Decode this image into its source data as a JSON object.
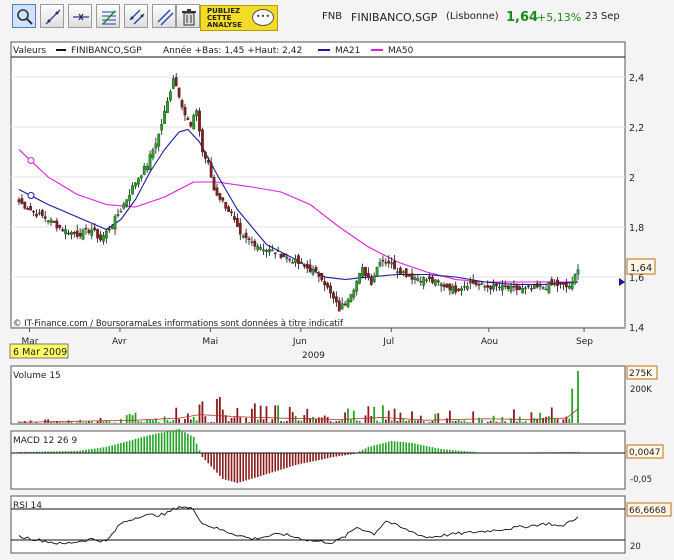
{
  "toolbar": {
    "tools": [
      {
        "name": "zoom-tool",
        "icon": "magnifier-icon"
      },
      {
        "name": "trend-line-tool",
        "icon": "trend-line-icon"
      },
      {
        "name": "horizontal-line-tool",
        "icon": "horizontal-line-icon"
      },
      {
        "name": "fibonacci-tool",
        "icon": "fibonacci-icon"
      },
      {
        "name": "channel-tool",
        "icon": "channel-icon"
      },
      {
        "name": "parallel-lines-tool",
        "icon": "parallel-lines-icon"
      },
      {
        "name": "delete-tool",
        "icon": "trash-icon"
      }
    ],
    "promo_text": "PUBLIEZ\nCETTE\nANALYSE"
  },
  "quote": {
    "code": "FNB",
    "name": "FINIBANCO,SGP",
    "exchange": "(Lisbonne)",
    "price": "1,64",
    "change": "+5,13%",
    "date": "23 Sep"
  },
  "colors": {
    "up": "#22a522",
    "down": "#8c1a1a",
    "ma21": "#1a1aa0",
    "ma50": "#e01ee0",
    "volume": "#22a522",
    "volume_down": "#8c1a1a",
    "price_tag": "#fff7e8",
    "date_tag": "#ffff66"
  },
  "main_panel": {
    "legend": {
      "label": "Valeurs",
      "series_name": "FINIBANCO,SGP",
      "range_text": "Année +Bas: 1,45 +Haut: 2,42",
      "ma21_label": "MA21",
      "ma50_label": "MA50"
    },
    "credit": "© IT-Finance.com / BoursoramaLes informations sont données à titre indicatif",
    "price_tag": "1,64",
    "y_ticks": [
      "2,4",
      "2,2",
      "2",
      "1,8",
      "1,6",
      "1,4"
    ],
    "x_months": [
      "Mar",
      "Avr",
      "Mai",
      "Jun",
      "Jul",
      "Aou",
      "Sep"
    ],
    "year_label": "2009",
    "date_tag": "6 Mar 2009"
  },
  "volume_panel": {
    "label": "Volume 15",
    "value_tag": "275K",
    "ticks": [
      "200K"
    ]
  },
  "macd_panel": {
    "label": "MACD 12 26 9",
    "value_tag": "0,0047",
    "ticks": [
      "-0,05"
    ]
  },
  "rsi_panel": {
    "label": "RSI 14",
    "value_tag": "66,6668",
    "ticks": [
      "20"
    ]
  },
  "chart_data": {
    "type": "candlestick",
    "title": "FINIBANCO,SGP",
    "ylim": [
      1.4,
      2.45
    ],
    "x_months": [
      "Mar",
      "Avr",
      "Mai",
      "Jun",
      "Jul",
      "Aou",
      "Sep"
    ],
    "close_anchors": [
      [
        0,
        1.9
      ],
      [
        5,
        1.86
      ],
      [
        10,
        1.83
      ],
      [
        15,
        1.79
      ],
      [
        20,
        1.77
      ],
      [
        25,
        1.79
      ],
      [
        28,
        1.75
      ],
      [
        32,
        1.81
      ],
      [
        35,
        1.87
      ],
      [
        40,
        1.98
      ],
      [
        44,
        2.05
      ],
      [
        48,
        2.17
      ],
      [
        51,
        2.3
      ],
      [
        53,
        2.4
      ],
      [
        55,
        2.33
      ],
      [
        57,
        2.25
      ],
      [
        59,
        2.2
      ],
      [
        61,
        2.27
      ],
      [
        63,
        2.1
      ],
      [
        65,
        2.05
      ],
      [
        67,
        1.95
      ],
      [
        70,
        1.9
      ],
      [
        73,
        1.85
      ],
      [
        76,
        1.76
      ],
      [
        80,
        1.74
      ],
      [
        85,
        1.71
      ],
      [
        90,
        1.69
      ],
      [
        95,
        1.66
      ],
      [
        100,
        1.63
      ],
      [
        104,
        1.6
      ],
      [
        107,
        1.53
      ],
      [
        110,
        1.47
      ],
      [
        112,
        1.5
      ],
      [
        115,
        1.56
      ],
      [
        118,
        1.63
      ],
      [
        121,
        1.58
      ],
      [
        124,
        1.67
      ],
      [
        127,
        1.66
      ],
      [
        130,
        1.63
      ],
      [
        135,
        1.6
      ],
      [
        140,
        1.59
      ],
      [
        145,
        1.57
      ],
      [
        150,
        1.55
      ],
      [
        155,
        1.58
      ],
      [
        160,
        1.56
      ],
      [
        165,
        1.56
      ],
      [
        170,
        1.55
      ],
      [
        175,
        1.55
      ],
      [
        180,
        1.56
      ],
      [
        184,
        1.57
      ],
      [
        188,
        1.56
      ],
      [
        190,
        1.57
      ],
      [
        192,
        1.64
      ]
    ],
    "ma21_anchors": [
      [
        0,
        1.95
      ],
      [
        10,
        1.89
      ],
      [
        20,
        1.84
      ],
      [
        30,
        1.79
      ],
      [
        35,
        1.83
      ],
      [
        40,
        1.91
      ],
      [
        45,
        2.02
      ],
      [
        50,
        2.11
      ],
      [
        55,
        2.18
      ],
      [
        58,
        2.19
      ],
      [
        62,
        2.14
      ],
      [
        68,
        2.01
      ],
      [
        75,
        1.87
      ],
      [
        85,
        1.73
      ],
      [
        95,
        1.67
      ],
      [
        105,
        1.6
      ],
      [
        112,
        1.59
      ],
      [
        120,
        1.6
      ],
      [
        130,
        1.61
      ],
      [
        140,
        1.61
      ],
      [
        150,
        1.6
      ],
      [
        160,
        1.58
      ],
      [
        170,
        1.57
      ],
      [
        180,
        1.57
      ],
      [
        192,
        1.58
      ]
    ],
    "ma50_anchors": [
      [
        0,
        2.11
      ],
      [
        10,
        2.0
      ],
      [
        20,
        1.93
      ],
      [
        30,
        1.89
      ],
      [
        40,
        1.88
      ],
      [
        50,
        1.92
      ],
      [
        60,
        1.98
      ],
      [
        68,
        1.98
      ],
      [
        80,
        1.96
      ],
      [
        90,
        1.94
      ],
      [
        100,
        1.89
      ],
      [
        110,
        1.8
      ],
      [
        120,
        1.72
      ],
      [
        130,
        1.66
      ],
      [
        140,
        1.62
      ],
      [
        150,
        1.59
      ],
      [
        160,
        1.58
      ],
      [
        170,
        1.58
      ],
      [
        180,
        1.58
      ],
      [
        192,
        1.58
      ]
    ],
    "volume_peak": [
      [
        0,
        0.05
      ],
      [
        40,
        0.2
      ],
      [
        55,
        0.35
      ],
      [
        62,
        0.6
      ],
      [
        75,
        0.45
      ],
      [
        90,
        0.35
      ],
      [
        110,
        0.25
      ],
      [
        125,
        0.4
      ],
      [
        140,
        0.2
      ],
      [
        160,
        0.3
      ],
      [
        175,
        0.25
      ],
      [
        188,
        0.35
      ],
      [
        192,
        1.0
      ]
    ],
    "macd": [
      [
        0,
        0.005
      ],
      [
        20,
        0.01
      ],
      [
        30,
        0.03
      ],
      [
        45,
        0.09
      ],
      [
        55,
        0.12
      ],
      [
        60,
        0.08
      ],
      [
        63,
        -0.02
      ],
      [
        70,
        -0.13
      ],
      [
        75,
        -0.15
      ],
      [
        82,
        -0.12
      ],
      [
        95,
        -0.06
      ],
      [
        108,
        -0.02
      ],
      [
        115,
        -0.005
      ],
      [
        120,
        0.03
      ],
      [
        128,
        0.06
      ],
      [
        135,
        0.05
      ],
      [
        145,
        0.02
      ],
      [
        160,
        0.0
      ],
      [
        175,
        0.003
      ],
      [
        192,
        0.0047
      ]
    ],
    "rsi": [
      [
        0,
        30
      ],
      [
        8,
        22
      ],
      [
        15,
        15
      ],
      [
        25,
        25
      ],
      [
        30,
        20
      ],
      [
        35,
        55
      ],
      [
        42,
        70
      ],
      [
        50,
        72
      ],
      [
        55,
        88
      ],
      [
        60,
        82
      ],
      [
        63,
        55
      ],
      [
        68,
        45
      ],
      [
        72,
        38
      ],
      [
        80,
        25
      ],
      [
        90,
        35
      ],
      [
        100,
        22
      ],
      [
        108,
        18
      ],
      [
        112,
        30
      ],
      [
        116,
        48
      ],
      [
        122,
        35
      ],
      [
        126,
        60
      ],
      [
        132,
        45
      ],
      [
        140,
        28
      ],
      [
        150,
        35
      ],
      [
        160,
        40
      ],
      [
        168,
        45
      ],
      [
        175,
        50
      ],
      [
        182,
        55
      ],
      [
        186,
        48
      ],
      [
        190,
        62
      ],
      [
        192,
        66.67
      ]
    ]
  }
}
